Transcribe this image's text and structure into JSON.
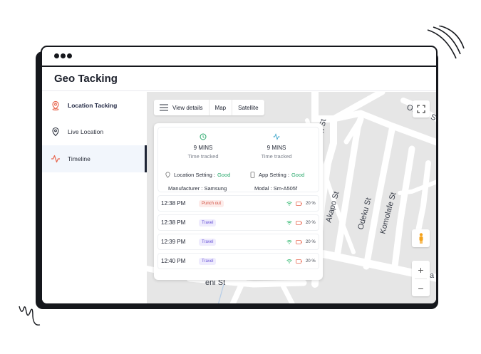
{
  "app": {
    "title": "Geo Tacking"
  },
  "sidebar": {
    "items": [
      {
        "label": "Location Tacking",
        "icon": "location-pin-icon",
        "color": "#e8674f"
      },
      {
        "label": "Live Location",
        "icon": "map-pin-icon"
      },
      {
        "label": "Timeline",
        "icon": "activity-icon",
        "color": "#e8674f",
        "active": true
      }
    ]
  },
  "map": {
    "toolbar": {
      "view_details": "View details",
      "map": "Map",
      "satellite": "Satellite"
    },
    "street_labels": [
      "Akapo St",
      "Odeku St",
      "Komolafe St",
      "Onadu S",
      "eni St",
      "n St",
      "a"
    ],
    "zoom_in": "+",
    "zoom_out": "−"
  },
  "stats": {
    "left": {
      "value": "9 MINS",
      "label": "Time tracked",
      "icon": "clock-icon"
    },
    "right": {
      "value": "9 MINS",
      "label": "Time tracked",
      "icon": "activity-icon"
    }
  },
  "settings": {
    "location_label": "Location Setting :",
    "location_value": "Good",
    "app_label": "App Setting :",
    "app_value": "Good",
    "manufacturer_label": "Manufacturer :",
    "manufacturer_value": "Samsung",
    "model_label": "Modal :",
    "model_value": "Sm-A505f"
  },
  "timeline": [
    {
      "time": "12:38 PM",
      "status": "Punch out",
      "type": "punch",
      "battery": "20 %"
    },
    {
      "time": "12:38 PM",
      "status": "Travel",
      "type": "travel",
      "battery": "20 %"
    },
    {
      "time": "12:39 PM",
      "status": "Travel",
      "type": "travel",
      "battery": "20 %"
    },
    {
      "time": "12:40 PM",
      "status": "Travel",
      "type": "travel",
      "battery": "20 %"
    }
  ],
  "colors": {
    "accent": "#e8674f",
    "good": "#27a86a",
    "wifi": "#2fb86e",
    "battery": "#e8674f"
  }
}
